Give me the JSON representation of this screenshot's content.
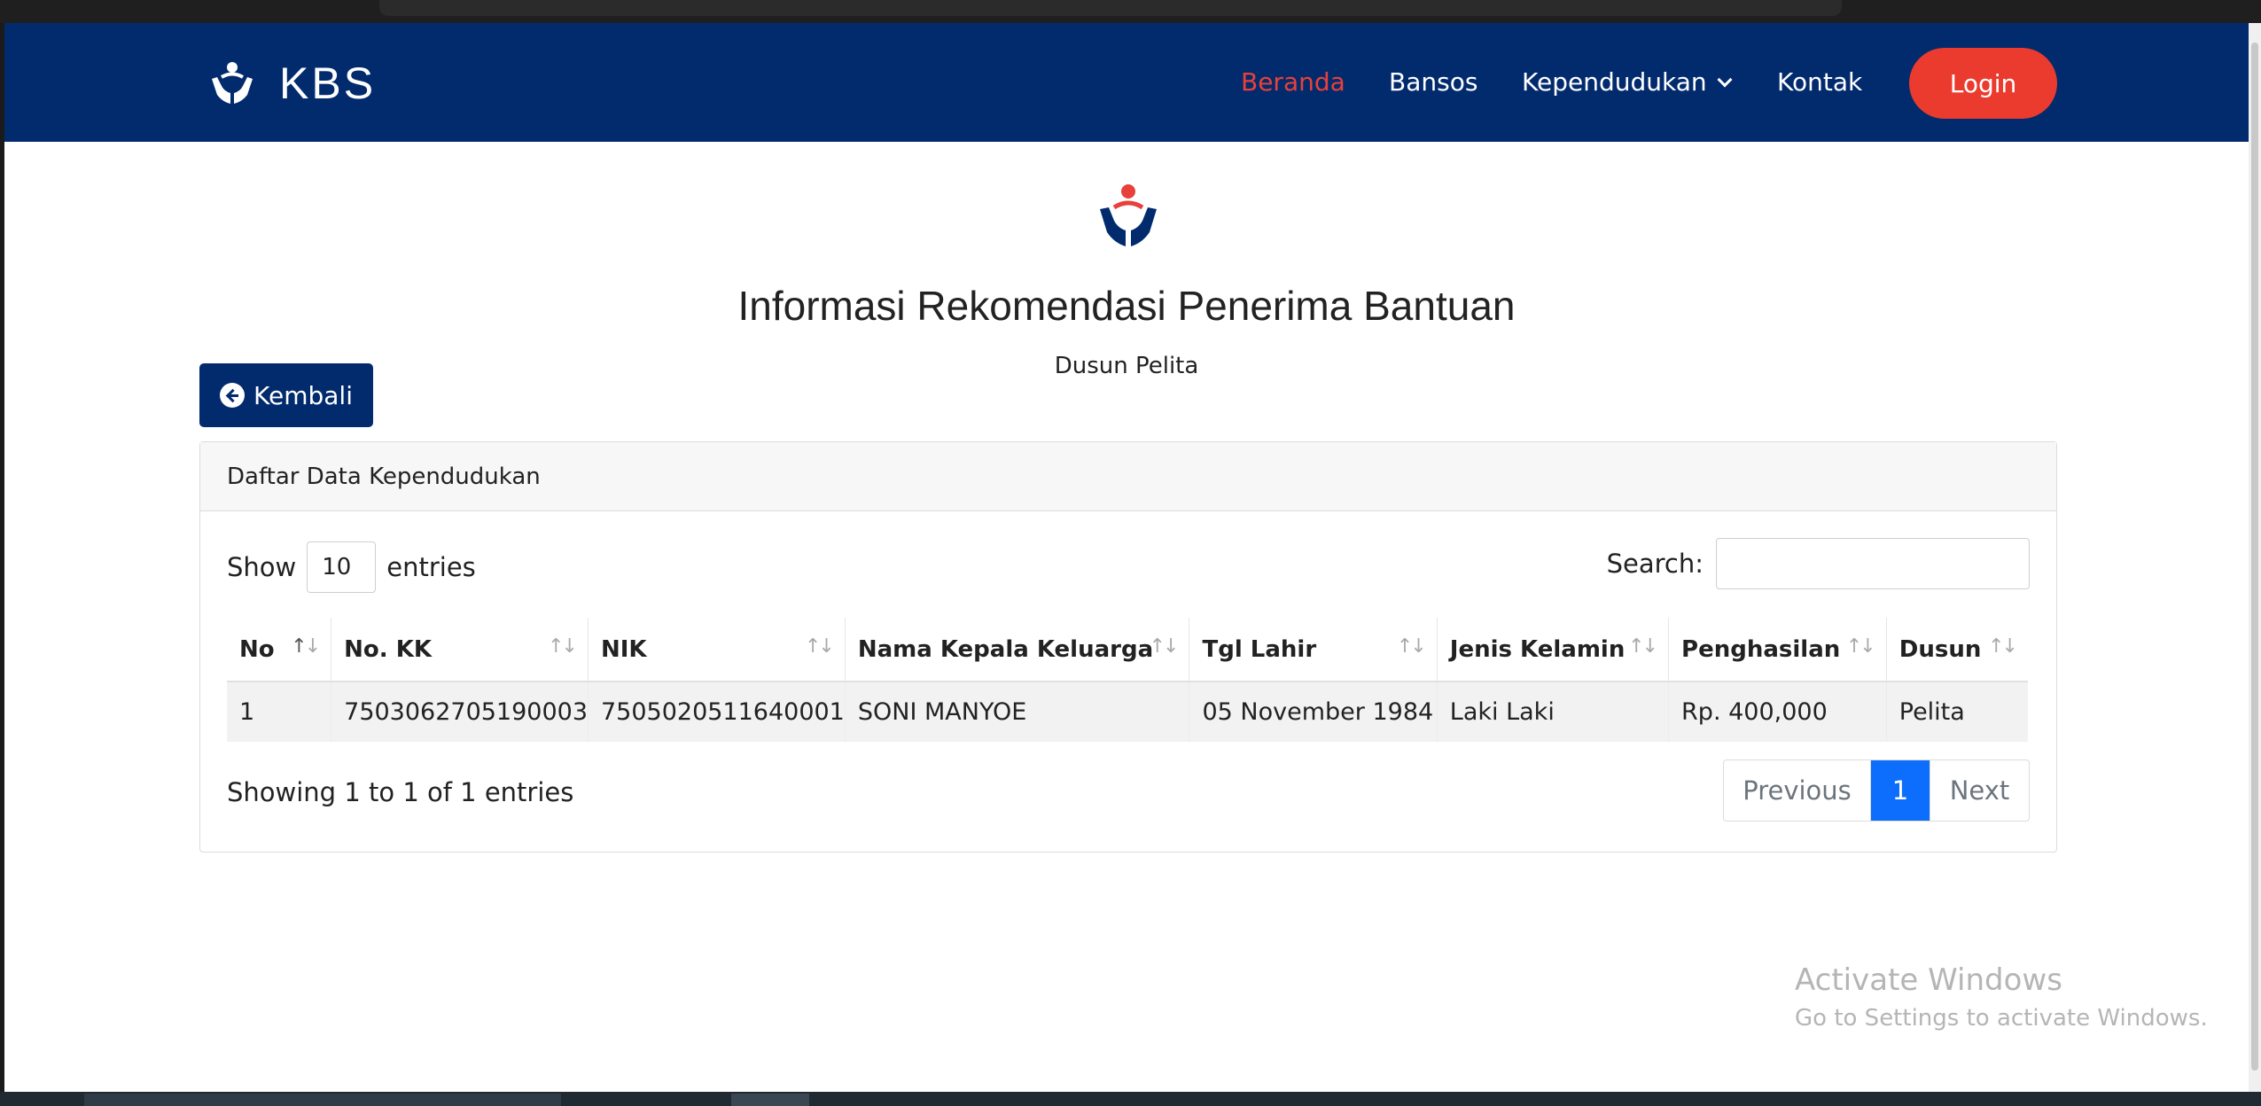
{
  "navbar": {
    "brand": "KBS",
    "links": [
      {
        "label": "Beranda",
        "active": true
      },
      {
        "label": "Bansos",
        "active": false
      },
      {
        "label": "Kependudukan",
        "active": false,
        "dropdown": true
      },
      {
        "label": "Kontak",
        "active": false
      }
    ],
    "login_label": "Login"
  },
  "header": {
    "title": "Informasi Rekomendasi Penerima Bantuan",
    "subtitle": "Dusun Pelita"
  },
  "back_label": "Kembali",
  "card": {
    "title": "Daftar Data Kependudukan",
    "show_label": "Show",
    "entries_label": "entries",
    "page_length": "10",
    "search_label": "Search:",
    "search_value": "",
    "columns": [
      "No",
      "No. KK",
      "NIK",
      "Nama Kepala Keluarga",
      "Tgl Lahir",
      "Jenis Kelamin",
      "Penghasilan",
      "Dusun"
    ],
    "rows": [
      [
        "1",
        "7503062705190003",
        "7505020511640001",
        "SONI MANYOE",
        "05 November 1984",
        "Laki Laki",
        "Rp. 400,000",
        "Pelita"
      ]
    ],
    "info": "Showing 1 to 1 of 1 entries",
    "pager": {
      "prev": "Previous",
      "current": "1",
      "next": "Next"
    }
  },
  "watermark": {
    "line1": "Activate Windows",
    "line2": "Go to Settings to activate Windows."
  },
  "colors": {
    "navbar": "#022b6e",
    "accent_red": "#ea3b2e",
    "active_link": "#e8403a",
    "pager_active": "#0d6efd"
  }
}
